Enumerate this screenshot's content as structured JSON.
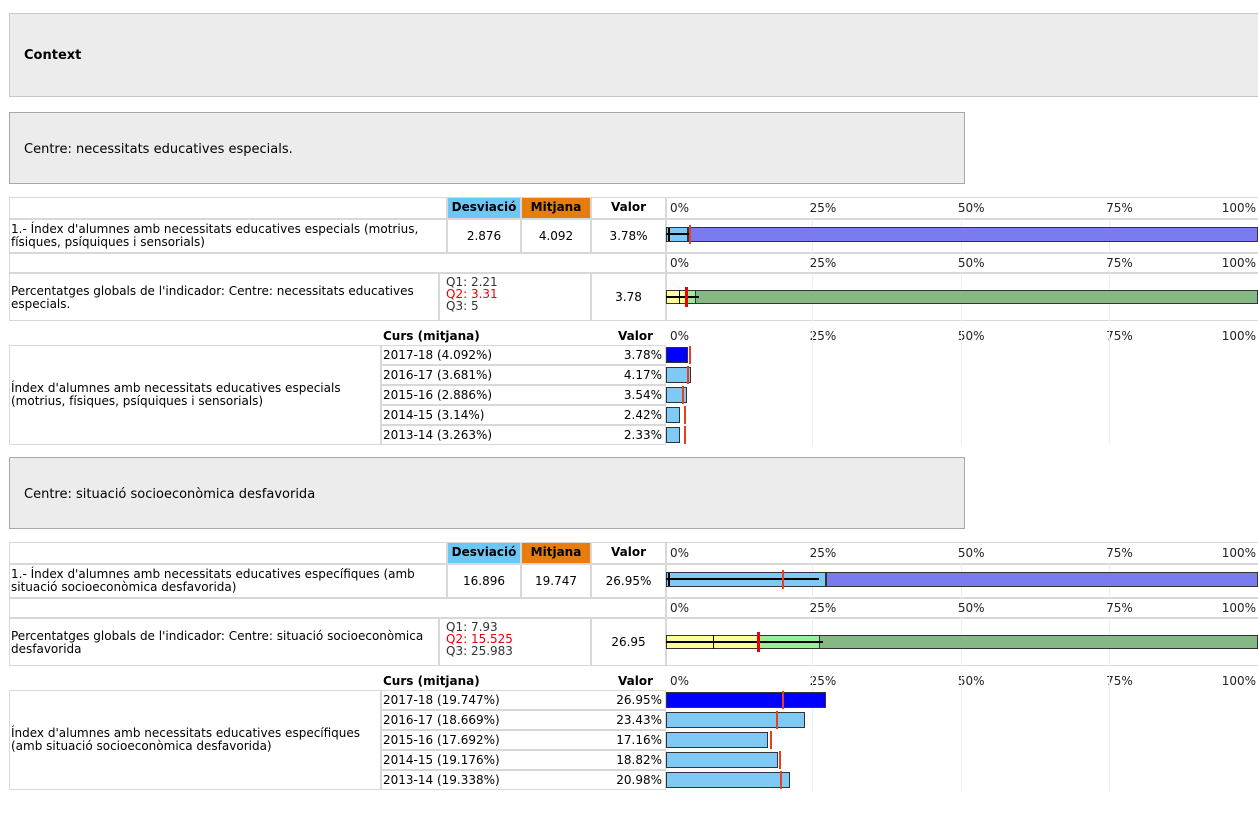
{
  "context_title": "Context",
  "ticks": [
    "0%",
    "25%",
    "50%",
    "75%",
    "100%"
  ],
  "headers": {
    "desviacio": "Desviació",
    "mitjana": "Mitjana",
    "valor": "Valor",
    "curs": "Curs (mitjana)"
  },
  "colors": {
    "desviacio_header": "#6cc7f5",
    "mitjana_header": "#e67e0f",
    "bar_current": "#0000ff",
    "bar_history": "#7fc9f5",
    "bar_total": "#7b7bf0",
    "bar_global": "#86b886",
    "median_marker": "#e8401c"
  },
  "sections": [
    {
      "title": "Centre: necessitats educatives especials.",
      "indicator": {
        "label_line1": "1.- Índex d'alumnes amb necessitats educatives especials (motrius,",
        "label_line2": "físiques, psíquiques i sensorials)",
        "desviacio": "2.876",
        "mitjana": "4.092",
        "valor": "3.78%",
        "value_pct": 3.78,
        "mean_pct": 4.092
      },
      "global": {
        "label_line1": "Percentatges globals de l'indicador: Centre: necessitats educatives",
        "label_line2": "especials.",
        "q1": "Q1: 2.21",
        "q2": "Q2: 3.31",
        "q3": "Q3: 5",
        "valor": "3.78",
        "q1_pct": 2.21,
        "q2_pct": 3.31,
        "q3_pct": 5
      },
      "history_label_line1": "Índex d'alumnes amb necessitats educatives especials",
      "history_label_line2": "(motrius, físiques, psíquiques i sensorials)",
      "history": [
        {
          "curs": "2017-18 (4.092%)",
          "valor": "3.78%",
          "value": 3.78,
          "mean": 4.092,
          "current": true
        },
        {
          "curs": "2016-17 (3.681%)",
          "valor": "4.17%",
          "value": 4.17,
          "mean": 3.681,
          "current": false
        },
        {
          "curs": "2015-16 (2.886%)",
          "valor": "3.54%",
          "value": 3.54,
          "mean": 2.886,
          "current": false
        },
        {
          "curs": "2014-15 (3.14%)",
          "valor": "2.42%",
          "value": 2.42,
          "mean": 3.14,
          "current": false
        },
        {
          "curs": "2013-14 (3.263%)",
          "valor": "2.33%",
          "value": 2.33,
          "mean": 3.263,
          "current": false
        }
      ]
    },
    {
      "title": "Centre: situació socioeconòmica desfavorida",
      "indicator": {
        "label_line1": "1.- Índex d'alumnes amb necessitats educatives específiques (amb",
        "label_line2": "situació socioeconòmica desfavorida)",
        "desviacio": "16.896",
        "mitjana": "19.747",
        "valor": "26.95%",
        "value_pct": 26.95,
        "mean_pct": 19.747
      },
      "global": {
        "label_line1": "Percentatges globals de l'indicador: Centre: situació socioeconòmica",
        "label_line2": "desfavorida",
        "q1": "Q1: 7.93",
        "q2": "Q2: 15.525",
        "q3": "Q3: 25.983",
        "valor": "26.95",
        "q1_pct": 7.93,
        "q2_pct": 15.525,
        "q3_pct": 25.983
      },
      "history_label_line1": "Índex d'alumnes amb necessitats educatives específiques",
      "history_label_line2": "(amb situació socioeconòmica desfavorida)",
      "history": [
        {
          "curs": "2017-18 (19.747%)",
          "valor": "26.95%",
          "value": 26.95,
          "mean": 19.747,
          "current": true
        },
        {
          "curs": "2016-17 (18.669%)",
          "valor": "23.43%",
          "value": 23.43,
          "mean": 18.669,
          "current": false
        },
        {
          "curs": "2015-16 (17.692%)",
          "valor": "17.16%",
          "value": 17.16,
          "mean": 17.692,
          "current": false
        },
        {
          "curs": "2014-15 (19.176%)",
          "valor": "18.82%",
          "value": 18.82,
          "mean": 19.176,
          "current": false
        },
        {
          "curs": "2013-14 (19.338%)",
          "valor": "20.98%",
          "value": 20.98,
          "mean": 19.338,
          "current": false
        }
      ]
    }
  ]
}
